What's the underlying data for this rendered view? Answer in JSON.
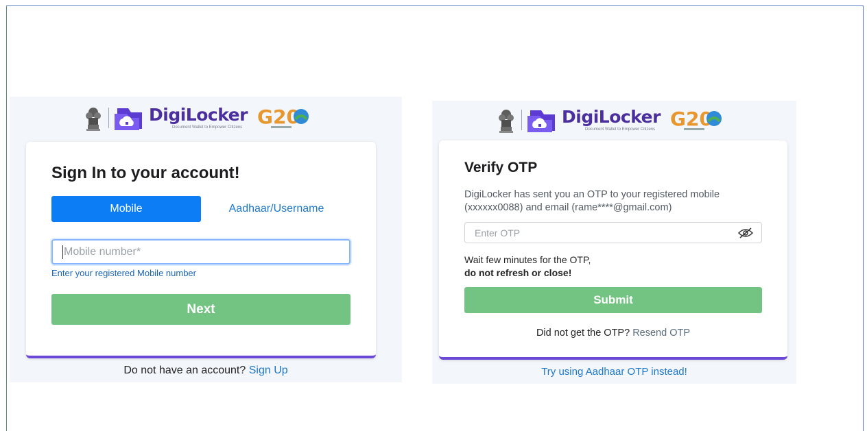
{
  "brand": {
    "name": "DigiLocker",
    "tagline": "Document Wallet to Empower Citizens",
    "g20": "G20"
  },
  "signin": {
    "title": "Sign In to your account!",
    "tab_mobile": "Mobile",
    "tab_aadhaar": "Aadhaar/Username",
    "mobile_placeholder": "Mobile number*",
    "hint": "Enter your registered Mobile number",
    "next_label": "Next",
    "no_account_text": "Do not have an account?",
    "signup_link": "Sign Up"
  },
  "otp": {
    "title": "Verify OTP",
    "description": "DigiLocker has sent you an OTP to your registered mobile (xxxxxx0088) and email (rame****@gmail.com)",
    "otp_placeholder": "Enter OTP",
    "wait_text": "Wait few minutes for the OTP,",
    "wait_bold": "do not refresh or close!",
    "submit_label": "Submit",
    "not_received": "Did not get the OTP?",
    "resend_link": "Resend OTP",
    "aadhaar_link": "Try using Aadhaar OTP instead!"
  },
  "colors": {
    "primary_blue": "#0d7df5",
    "button_green": "#73c483",
    "brand_purple": "#4b2f9e",
    "card_accent": "#6c48d6",
    "link_blue": "#1f78c8"
  },
  "icons": {
    "emblem": "national-emblem-icon",
    "digilocker": "digilocker-logo-icon",
    "g20": "g20-logo-icon",
    "eye": "eye-slash-icon"
  }
}
